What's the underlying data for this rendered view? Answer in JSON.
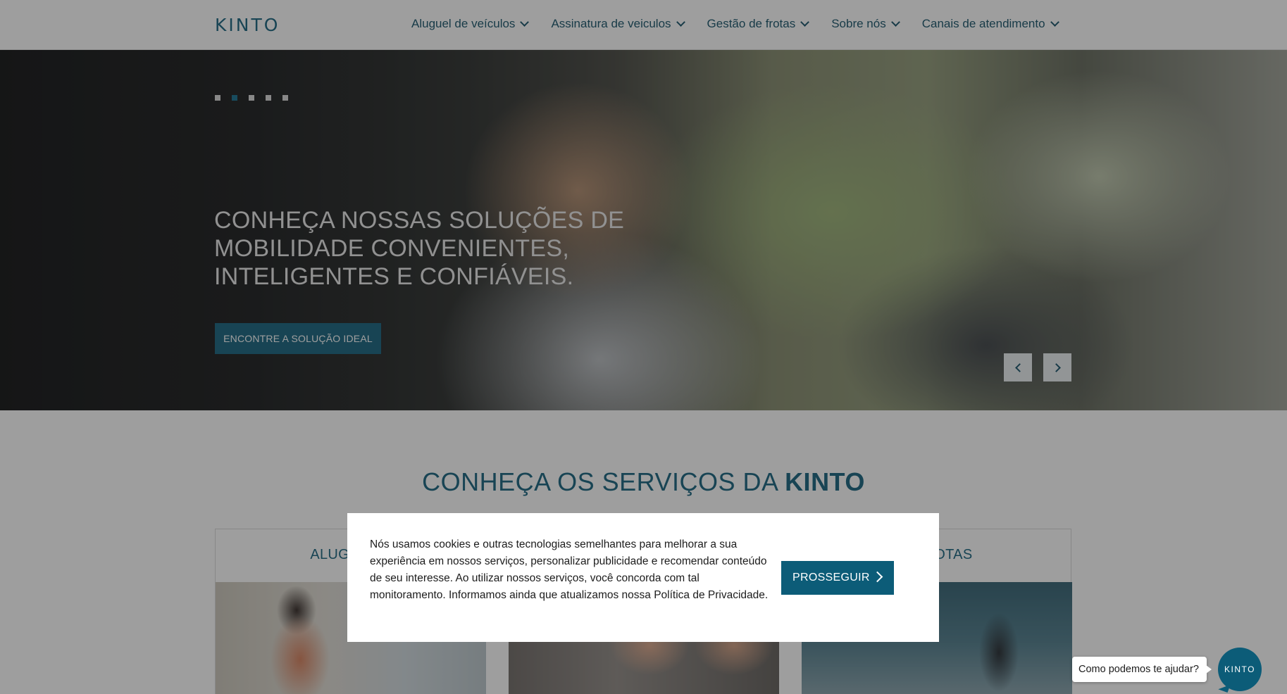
{
  "header": {
    "logo": "KINTO",
    "nav": [
      {
        "label": "Aluguel de veículos"
      },
      {
        "label": "Assinatura de veiculos"
      },
      {
        "label": "Gestão de frotas"
      },
      {
        "label": "Sobre nós"
      },
      {
        "label": "Canais de atendimento"
      }
    ]
  },
  "hero": {
    "slides_total": 5,
    "active_slide": 2,
    "title": "CONHEÇA NOSSAS SOLUÇÕES DE MOBILIDADE CONVENIENTES, INTELIGENTES E CONFIÁVEIS.",
    "cta_label": "ENCONTRE A SOLUÇÃO IDEAL"
  },
  "services": {
    "title_prefix": "CONHEÇA OS SERVIÇOS DA ",
    "title_brand": "KINTO",
    "cards": [
      {
        "title": "ALUGUEL D"
      },
      {
        "title": ""
      },
      {
        "title": "E FROTAS"
      }
    ]
  },
  "cookie": {
    "text": "Nós usamos cookies e outras tecnologias semelhantes para melhorar a sua experiência em nossos serviços, personalizar publicidade e recomendar conteúdo de seu interesse. Ao utilizar nossos serviços, você concorda com tal monitoramento. Informamos ainda que atualizamos nossa Política de Privacidade.",
    "button_label": "PROSSEGUIR"
  },
  "chat": {
    "prompt": "Como podemos te ajudar?",
    "button_label": "KINTO"
  },
  "colors": {
    "brand": "#0c5c78",
    "overlay": "rgba(40,40,40,0.45)"
  }
}
